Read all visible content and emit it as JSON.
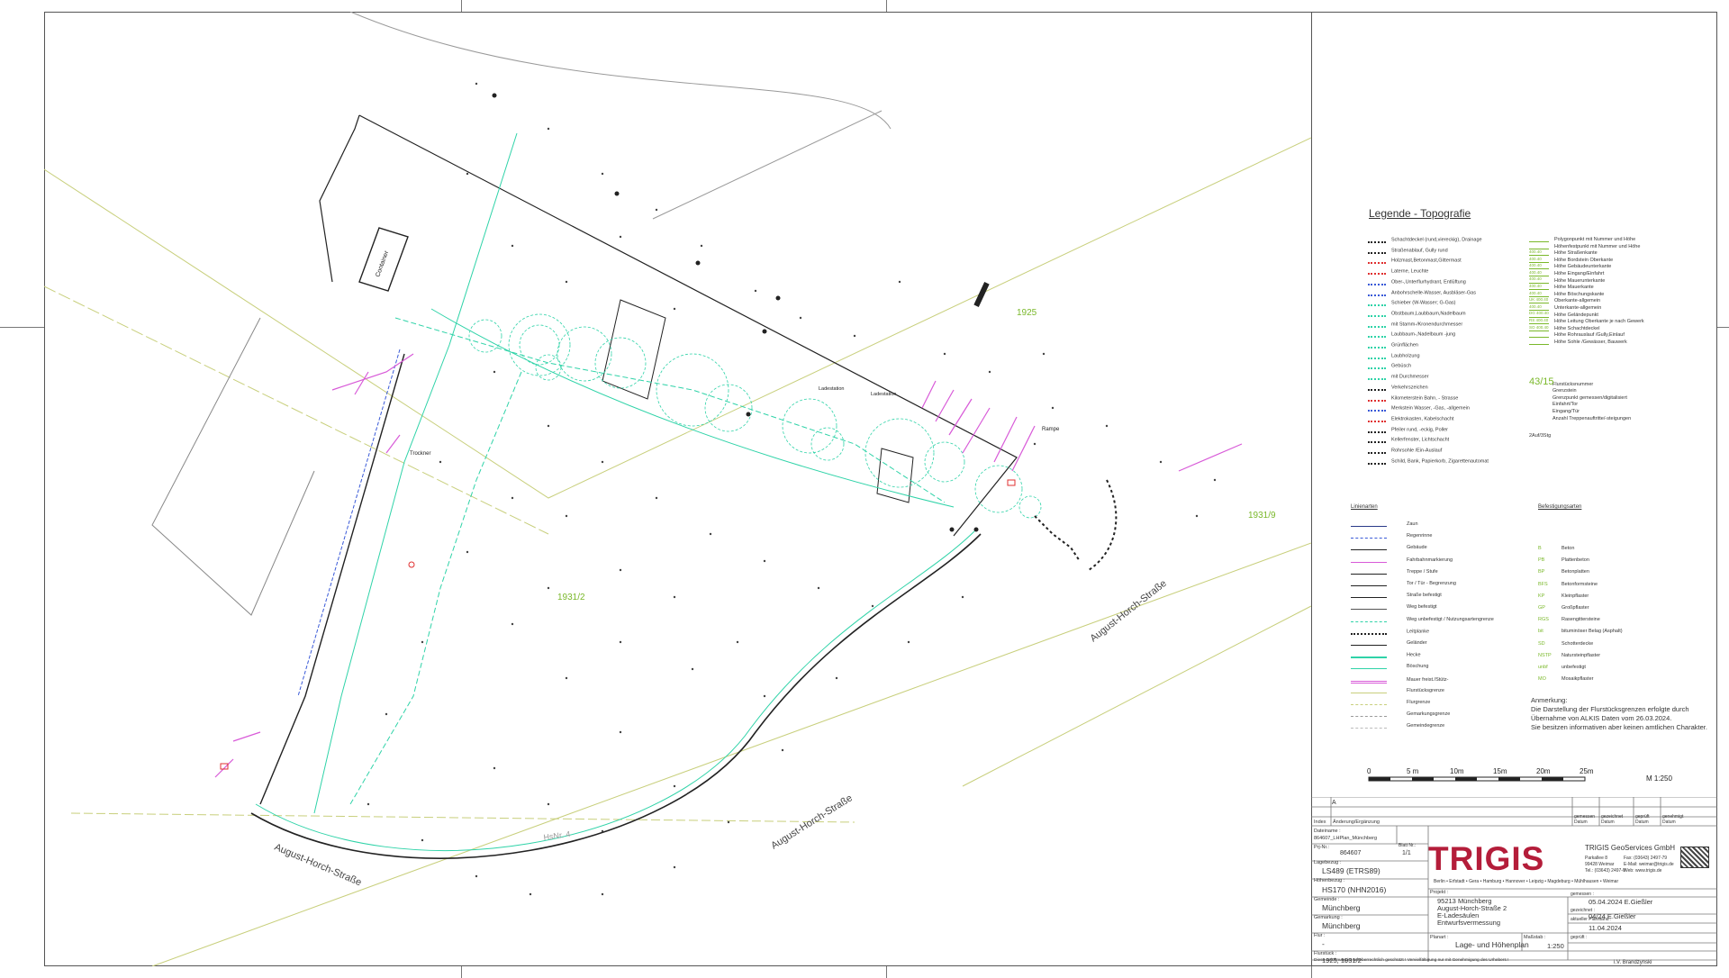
{
  "parcels": {
    "p1925": "1925",
    "p1931_2": "1931/2",
    "p1931_9": "1931/9",
    "hsnr": "HsNr. 4"
  },
  "streets": {
    "bottom_left": "August-Horch-Straße",
    "bottom_mid": "August-Horch-Straße",
    "right": "August-Horch-Straße"
  },
  "map_labels": {
    "container": "Container",
    "trockner": "Trockner",
    "rampe": "Rampe",
    "ladestation": "Ladestation",
    "ladestation2": "Ladestation"
  },
  "legend": {
    "title": "Legende - Topografie",
    "left_items": [
      "Schachtdeckel (rund,viereckig), Drainage",
      "Straßenablauf, Gully rund",
      "Holzmast,Betonmast,Gittermast",
      "Laterne, Leuchte",
      "Ober-,Unterflurhydrant, Entlüftung",
      "Anbohrschelle-Wasser, Ausbläser-Gas",
      "Schieber (W-Wasser; G-Gas)",
      "Obstbaum,Laubbaum,Nadelbaum",
      "mit Stamm-/Kronendurchmesser",
      "Laubbaum-,Nadelbaum -jung",
      "Grünflächen",
      "Laubholzung",
      "Gebüsch",
      "mit Durchmesser",
      "Verkehrszeichen",
      "Kilometerstein Bahn, - Strasse",
      "Merkstein Wasser, -Gas, -allgemein",
      "Elektrokasten, Kabelschacht",
      "Pfeiler rund, -eckig, Poller",
      "Kellerfenster, Lichtschacht",
      "Rohrsohle /Ein-Auslauf",
      "Schild, Bank, Papierkorb, Zigarettenautomat"
    ],
    "right_items": [
      "Polygonpunkt mit Nummer und Höhe",
      "Höhenfestpunkt mit Nummer und Höhe",
      "Höhe Straßenkante",
      "Höhe Bordstein Oberkante",
      "Höhe Gebäudeunterkante",
      "Höhe Eingang/Einfahrt",
      "Höhe Mauerunterkante",
      "Höhe Mauerkante",
      "Höhe Böschungskante",
      "Oberkante-allgemein",
      "Unterkante-allgemein",
      "Höhe Geländepunkt",
      "Höhe Leitung Oberkante je nach Gewerk",
      "Höhe Schachtdeckel",
      "Höhe Rohrauslauf /Gully,Einlauf",
      "Höhe Sohle /Gewässer, Bauwerk",
      "Flurstücksnummer",
      "Grenzstein",
      "Grenzpunkt gemessen/digitalisiert",
      "Einfahrt/Tor",
      "Eingang/Tür",
      "Anzahl Treppenauftritte/-steigungen"
    ],
    "sample_values": [
      "400.40",
      "400.40",
      "400.40",
      "400.40",
      "400.40",
      "400.40",
      "400.40",
      "UK 400.40",
      "400.40",
      "DG 400.40",
      "RS 400.40",
      "SO 400.40"
    ],
    "parcel_sample": "43/15",
    "stairs_sample": "2Auf/3Stg",
    "line_types_title": "Linienarten",
    "line_types": [
      "Zaun",
      "Regenrinne",
      "Gebäude",
      "Fahrbahnmarkierung",
      "Treppe / Stufe",
      "Tor / Tür - Begrenzung",
      "Straße befestigt",
      "Weg befestigt",
      "Weg unbefestigt / Nutzungsartengrenze",
      "Leitplanke",
      "Geländer",
      "Hecke",
      "Böschung",
      "Mauer freist./Stütz-",
      "Flurstücksgrenze",
      "Flurgrenze",
      "Gemarkungsgrenze",
      "Gemeindegrenze"
    ],
    "surfaces_title": "Befestigungsarten",
    "surface_codes": [
      "B",
      "PB",
      "BP",
      "BFS",
      "KP",
      "GP",
      "RGS",
      "bit",
      "SD",
      "NSTP",
      "unbf",
      "MO"
    ],
    "surfaces": [
      "Beton",
      "Plattenbeton",
      "Betonplatten",
      "Betonformsteine",
      "Kleinpflaster",
      "Großpflaster",
      "Rasengittersteine",
      "bituminöser Belag (Asphalt)",
      "Schotterdecke",
      "Natursteinpflaster",
      "unbefestigt",
      "Mosaikpflaster"
    ]
  },
  "note": {
    "title": "Anmerkung:",
    "lines": [
      "Die Darstellung der Flurstücksgrenzen erfolgte durch",
      "Übernahme von ALKIS Daten vom 26.03.2024.",
      "Sie besitzen informativen aber keinen amtlichen Charakter."
    ]
  },
  "scale_bar": {
    "ticks": [
      "0",
      "5 m",
      "10m",
      "15m",
      "20m",
      "25m"
    ],
    "ratio": "M 1:250"
  },
  "title_block": {
    "rev_letter": "A",
    "index_label": "Index",
    "change_label": "Änderung/Ergänzung",
    "measured_label": "gemessen",
    "drawn_label": "gezeichnet",
    "checked_label": "geprüft",
    "released_label": "genehmigt",
    "date_label": "Datum",
    "name_label": "Name",
    "file_label": "Dateiname :",
    "file_value": "864607_LHPlan_Münchberg",
    "prj_label": "Prj-Nr.:",
    "prj_value": "864607",
    "sheet_label": "Blatt Nr.:",
    "sheet_value": "1/1",
    "lage_label": "Lagebezug :",
    "lage_value": "LS489 (ETRS89)",
    "hoehe_label": "Höhenbezug :",
    "hoehe_value": "HS170 (NHN2016)",
    "gemeinde_label": "Gemeinde :",
    "gemeinde_value": "Münchberg",
    "gemarkung_label": "Gemarkung :",
    "gemarkung_value": "Münchberg",
    "flur_label": "Flur :",
    "flur_value": "-",
    "flurstueck_label": "Flurstück :",
    "flurstueck_value": "1925, 1931/2",
    "projekt_label": "Projekt :",
    "projekt_lines": [
      "95213 Münchberg",
      "August-Horch-Straße 2",
      "E-Ladesäulen",
      "Entwurfsvermessung"
    ],
    "planart_label": "Planart :",
    "planart_value": "Lage- und Höhenplan",
    "massstab_label": "Maßstab :",
    "massstab_value": "1:250",
    "gemessen_label": "gemessen :",
    "gemessen_value": "05.04.2024  E.Gießler",
    "gezeichnet_label": "gezeichnet :",
    "gezeichnet_value": "04/24  E.Gießler",
    "aktuell_label": "aktueller Planstand :",
    "aktuell_value": "11.04.2024",
    "geprueft_label": "geprüft :",
    "geprueft_value": "i.V. Brandzynski",
    "logo": "TRIGIS",
    "company": "TRIGIS GeoServices GmbH",
    "address": [
      "Parkallee 8",
      "99428 Weimar",
      "Tel.: (03643) 2497-0"
    ],
    "contact": [
      "Fax: (03643) 2497-79",
      "E-Mail: weimar@trigis.de",
      "Web: www.trigis.de"
    ],
    "offices": "Berlin • Erfstadt • Gera • Hamburg • Hannover • Leipzig • Magdeburg • Mühlhausen • Weimar",
    "footer": "Diese Zeichnung ist urheberrechtlich geschützt ! Vervielfältigung nur mit Genehmigung des Urhebers !"
  },
  "colors": {
    "building": "#222222",
    "measure": "#2fd3a8",
    "marking": "#d85ad8",
    "parcel": "#b8c24a",
    "label_green": "#7ab82a",
    "brand": "#b41d3a"
  }
}
